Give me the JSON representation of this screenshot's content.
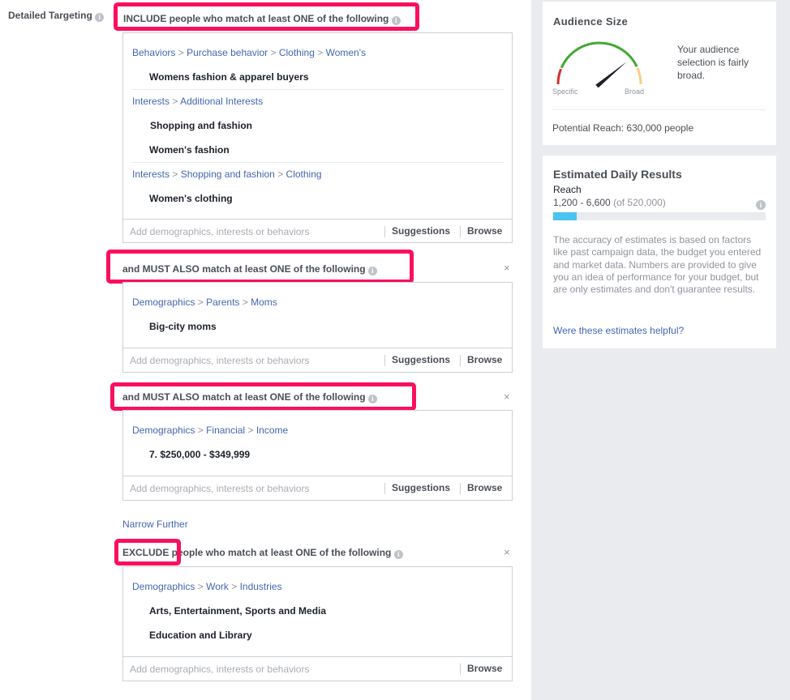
{
  "detailed_targeting": {
    "label": "Detailed Targeting",
    "info_icon": "info-icon",
    "groups": [
      {
        "header": "INCLUDE people who match at least ONE of the following",
        "sections": [
          {
            "path": [
              "Behaviors",
              "Purchase behavior",
              "Clothing",
              "Women's"
            ],
            "items": [
              "Womens fashion & apparel buyers"
            ]
          },
          {
            "path": [
              "Interests",
              "Additional Interests"
            ],
            "items": [
              "Shopping and fashion",
              "Women's fashion"
            ]
          },
          {
            "path": [
              "Interests",
              "Shopping and fashion",
              "Clothing"
            ],
            "items": [
              "Women's clothing"
            ]
          }
        ],
        "placeholder": "Add demographics, interests or behaviors",
        "suggestions": "Suggestions",
        "browse": "Browse"
      },
      {
        "header": "and MUST ALSO match at least ONE of the following",
        "sections": [
          {
            "path": [
              "Demographics",
              "Parents",
              "Moms"
            ],
            "items": [
              "Big-city moms"
            ]
          }
        ],
        "placeholder": "Add demographics, interests or behaviors",
        "suggestions": "Suggestions",
        "browse": "Browse",
        "close": "×"
      },
      {
        "header": "and MUST ALSO match at least ONE of the following",
        "sections": [
          {
            "path": [
              "Demographics",
              "Financial",
              "Income"
            ],
            "items": [
              "7. $250,000 - $349,999"
            ]
          }
        ],
        "placeholder": "Add demographics, interests or behaviors",
        "suggestions": "Suggestions",
        "browse": "Browse",
        "close": "×"
      },
      {
        "header": "EXCLUDE people who match at least ONE of the following",
        "sections": [
          {
            "path": [
              "Demographics",
              "Work",
              "Industries"
            ],
            "items": [
              "Arts, Entertainment, Sports and Media",
              "Education and Library"
            ]
          }
        ],
        "placeholder": "Add demographics, interests or behaviors",
        "browse": "Browse",
        "close": "×"
      }
    ],
    "narrow_further": "Narrow Further",
    "path_separator": ">"
  },
  "audience_size": {
    "title": "Audience Size",
    "gauge_level": 0.78,
    "specific_label": "Specific",
    "broad_label": "Broad",
    "description": "Your audience selection is fairly broad.",
    "potential_reach": "Potential Reach: 630,000 people",
    "colors": {
      "specific": "#d42f2f",
      "middle": "#42a832",
      "broad": "#fdc98a",
      "needle": "#1d2129"
    }
  },
  "estimated_daily_results": {
    "title": "Estimated Daily Results",
    "metric": "Reach",
    "range": "1,200 - 6,600",
    "of_total": "(of 520,000)",
    "progress_fraction": 0.11,
    "bar_color": "#4ac3ee",
    "disclaimer": "The accuracy of estimates is based on factors like past campaign data, the budget you entered and market data. Numbers are provided to give you an idea of performance for your budget, but are only estimates and don't guarantee results.",
    "feedback_link": "Were these estimates helpful?"
  },
  "highlight_color": "#fa0f5f"
}
